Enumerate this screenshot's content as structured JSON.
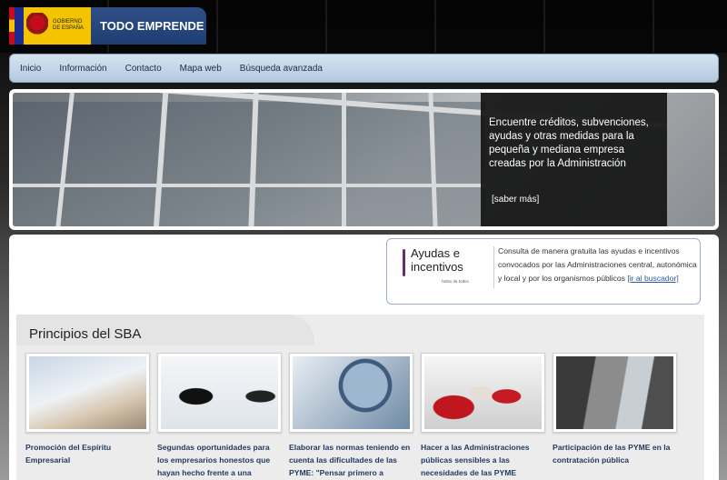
{
  "header": {
    "gov_line1": "GOBIERNO",
    "gov_line2": "DE ESPAÑA",
    "site_title": "TODO EMPRENDE"
  },
  "nav": {
    "items": [
      "Inicio",
      "Información",
      "Contacto",
      "Mapa web",
      "Búsqueda avanzada"
    ]
  },
  "hero": {
    "caption": "Encuentre créditos, subvenciones, ayudas y otras medidas para la pequeña y mediana empresa creadas por la Administración",
    "more_link": "[saber más]"
  },
  "ayudas": {
    "logo_title_1": "Ayudas e",
    "logo_title_2": "incentivos",
    "logo_subtitle": "todos de todos",
    "text": "Consulta de manera gratuita las ayudas e incentivos convocados por las Administraciones central, autonómica y local y por los organismos públicos",
    "link": "[ir al buscador]"
  },
  "principios": {
    "title": "Principios del SBA",
    "cards": [
      {
        "caption": "Promoción del Espíritu Empresarial"
      },
      {
        "caption": "Segundas oportunidades para los empresarios honestos que hayan hecho frente a una"
      },
      {
        "caption": "Elaborar las normas teniendo en cuenta las dificultades de las PYME: \"Pensar primero a"
      },
      {
        "caption": "Hacer a las Administraciones públicas sensibles a las necesidades de las PYME"
      },
      {
        "caption": "Participación de las PYME en la contratación pública"
      }
    ]
  },
  "colors": {
    "nav_bg": "#c5d6e8",
    "title_bar": "#2e4f86",
    "link": "#2a5aa0",
    "card_caption": "#233a63"
  }
}
